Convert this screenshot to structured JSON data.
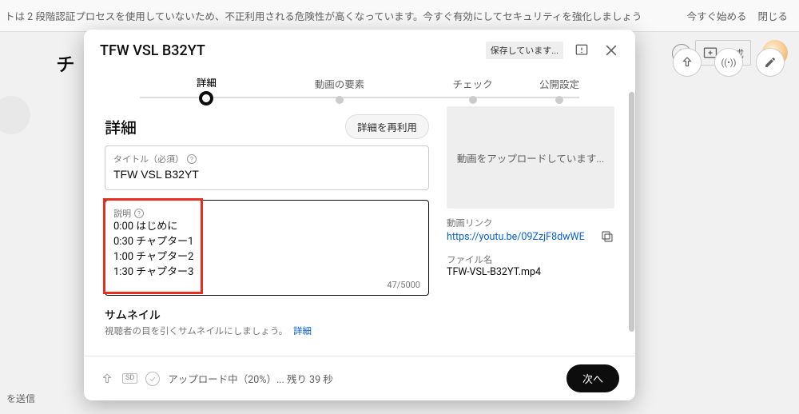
{
  "banner": {
    "text": "トは 2 段階認証プロセスを使用していないため、不正利用される危険性が高くなっています。今すぐ有効にしてセキュリティを強化しましょう",
    "start": "今すぐ始める",
    "close": "閉じる"
  },
  "background": {
    "title_fragment": "チ",
    "create_label": "作成",
    "sidechar": "を送信"
  },
  "modal": {
    "title": "TFW VSL B32YT",
    "saving": "保存しています...",
    "steps": [
      "詳細",
      "動画の要素",
      "チェック",
      "公開設定"
    ],
    "section_title": "詳細",
    "reuse_label": "詳細を再利用",
    "title_field_label": "タイトル（必須）",
    "title_value": "TFW VSL B32YT",
    "desc_label": "説明",
    "desc_value": "0:00 はじめに\n0:30 チャプター1\n1:00 チャプター2\n1:30 チャプター3",
    "char_count": "47/5000",
    "thumbnail_title": "サムネイル",
    "thumbnail_sub": "視聴者の目を引くサムネイルにしましょう。",
    "thumbnail_link": "詳細",
    "preview_text": "動画をアップロードしています...",
    "link_label": "動画リンク",
    "link_value": "https://youtu.be/09ZzjF8dwWE",
    "file_label": "ファイル名",
    "file_value": "TFW-VSL-B32YT.mp4",
    "upload_status": "アップロード中（20%）... 残り 39 秒",
    "next_label": "次へ"
  }
}
